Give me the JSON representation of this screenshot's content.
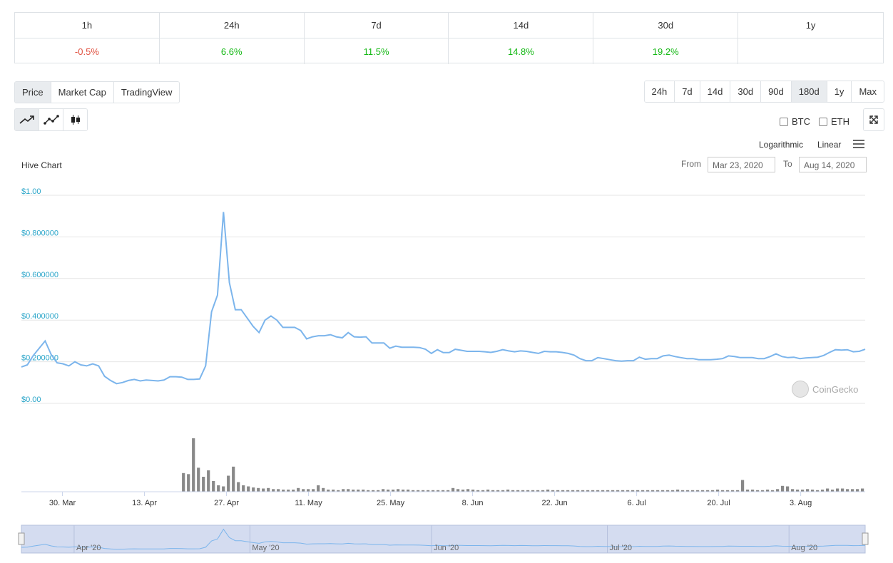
{
  "performance": {
    "headers": [
      "1h",
      "24h",
      "7d",
      "14d",
      "30d",
      "1y"
    ],
    "values": [
      "-0.5%",
      "6.6%",
      "11.5%",
      "14.8%",
      "19.2%",
      ""
    ],
    "signs": [
      "neg",
      "pos",
      "pos",
      "pos",
      "pos",
      ""
    ]
  },
  "tabs": [
    "Price",
    "Market Cap",
    "TradingView"
  ],
  "ranges": [
    "24h",
    "7d",
    "14d",
    "30d",
    "90d",
    "180d",
    "1y",
    "Max"
  ],
  "active_range": "180d",
  "compare": {
    "btc": "BTC",
    "eth": "ETH"
  },
  "scale": {
    "log": "Logarithmic",
    "linear": "Linear"
  },
  "date_range": {
    "from_label": "From",
    "from": "Mar 23, 2020",
    "to_label": "To",
    "to": "Aug 14, 2020"
  },
  "watermark": "CoinGecko",
  "colors": {
    "line": "#7cb5ec",
    "axis_label": "#2aa5c9",
    "volume": "#888888",
    "navigator_bg": "#ccd6eb"
  },
  "chart_data": {
    "type": "line",
    "title": "Hive Chart",
    "ylim": [
      0,
      1
    ],
    "y_ticks": [
      "$1.00",
      "$0.800000",
      "$0.600000",
      "$0.400000",
      "$0.200000",
      "$0.00"
    ],
    "x_ticks": [
      "30. Mar",
      "13. Apr",
      "27. Apr",
      "11. May",
      "25. May",
      "8. Jun",
      "22. Jun",
      "6. Jul",
      "20. Jul",
      "3. Aug"
    ],
    "x_start": "2020-03-23",
    "series": [
      {
        "name": "Price",
        "values": [
          0.175,
          0.185,
          0.23,
          0.265,
          0.3,
          0.235,
          0.195,
          0.19,
          0.18,
          0.2,
          0.185,
          0.18,
          0.19,
          0.18,
          0.13,
          0.11,
          0.095,
          0.1,
          0.11,
          0.115,
          0.108,
          0.112,
          0.11,
          0.108,
          0.112,
          0.128,
          0.128,
          0.126,
          0.115,
          0.115,
          0.117,
          0.18,
          0.44,
          0.52,
          0.92,
          0.58,
          0.45,
          0.45,
          0.41,
          0.37,
          0.34,
          0.4,
          0.42,
          0.4,
          0.365,
          0.365,
          0.365,
          0.35,
          0.31,
          0.32,
          0.325,
          0.325,
          0.33,
          0.32,
          0.315,
          0.34,
          0.32,
          0.318,
          0.32,
          0.29,
          0.29,
          0.29,
          0.265,
          0.275,
          0.27,
          0.27,
          0.27,
          0.268,
          0.26,
          0.24,
          0.258,
          0.244,
          0.244,
          0.26,
          0.255,
          0.25,
          0.25,
          0.25,
          0.248,
          0.245,
          0.25,
          0.258,
          0.252,
          0.248,
          0.252,
          0.25,
          0.245,
          0.24,
          0.25,
          0.248,
          0.248,
          0.245,
          0.24,
          0.232,
          0.215,
          0.205,
          0.205,
          0.22,
          0.215,
          0.21,
          0.205,
          0.203,
          0.205,
          0.205,
          0.222,
          0.212,
          0.215,
          0.215,
          0.228,
          0.232,
          0.225,
          0.22,
          0.215,
          0.215,
          0.21,
          0.21,
          0.21,
          0.212,
          0.215,
          0.228,
          0.225,
          0.22,
          0.22,
          0.22,
          0.215,
          0.215,
          0.225,
          0.238,
          0.225,
          0.22,
          0.222,
          0.215,
          0.218,
          0.22,
          0.222,
          0.23,
          0.245,
          0.258,
          0.256,
          0.258,
          0.248,
          0.25,
          0.26
        ]
      },
      {
        "name": "Volume",
        "values": [
          0,
          0,
          0,
          0,
          0,
          0,
          0,
          0,
          0,
          0,
          0,
          0,
          0,
          0,
          0,
          0,
          0,
          0,
          0,
          0,
          0,
          0,
          0,
          0,
          0,
          0,
          0,
          0,
          0,
          0,
          0,
          0,
          35,
          33,
          100,
          45,
          28,
          40,
          20,
          12,
          10,
          30,
          47,
          18,
          12,
          10,
          8,
          7,
          6,
          7,
          5,
          5,
          4,
          4,
          4,
          7,
          5,
          5,
          5,
          12,
          7,
          4,
          4,
          3,
          5,
          5,
          4,
          4,
          4,
          3,
          3,
          3,
          5,
          4,
          4,
          5,
          4,
          4,
          3,
          3,
          3,
          3,
          3,
          3,
          3,
          3,
          7,
          5,
          4,
          5,
          4,
          3,
          3,
          4,
          3,
          3,
          3,
          4,
          3,
          3,
          3,
          3,
          3,
          3,
          3,
          4,
          3,
          3,
          3,
          3,
          3,
          3,
          3,
          3,
          3,
          3,
          3,
          3,
          3,
          3,
          3,
          3,
          3,
          3,
          3,
          3,
          3,
          3,
          3,
          3,
          3,
          4,
          3,
          3,
          3,
          3,
          3,
          3,
          3,
          4,
          3,
          3,
          3,
          3,
          22,
          4,
          4,
          3,
          3,
          4,
          3,
          5,
          11,
          10,
          5,
          4,
          4,
          5,
          4,
          3,
          4,
          6,
          4,
          6,
          6,
          5,
          5,
          5,
          6
        ]
      }
    ],
    "navigator_ticks": [
      "Apr '20",
      "May '20",
      "Jun '20",
      "Jul '20",
      "Aug '20"
    ]
  }
}
